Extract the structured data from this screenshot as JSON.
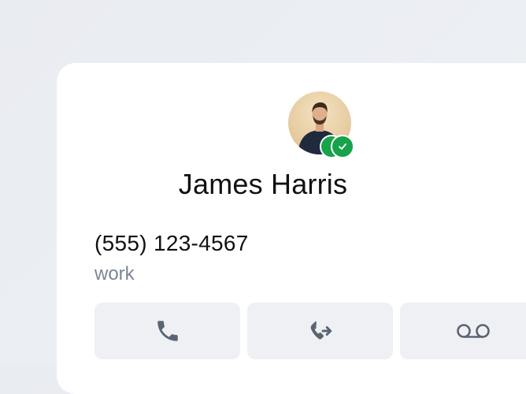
{
  "contact": {
    "name": "James Harris",
    "status": "online",
    "verified": true
  },
  "phone": {
    "number": "(555) 123-4567",
    "label": "work"
  },
  "actions": [
    {
      "id": "call",
      "icon": "phone-icon"
    },
    {
      "id": "transfer",
      "icon": "phone-forward-icon"
    },
    {
      "id": "voicemail",
      "icon": "voicemail-icon"
    }
  ],
  "colors": {
    "status_green": "#16a34a",
    "icon_gray": "#5b6474",
    "button_bg": "#eef0f4",
    "label_gray": "#7b8594"
  }
}
